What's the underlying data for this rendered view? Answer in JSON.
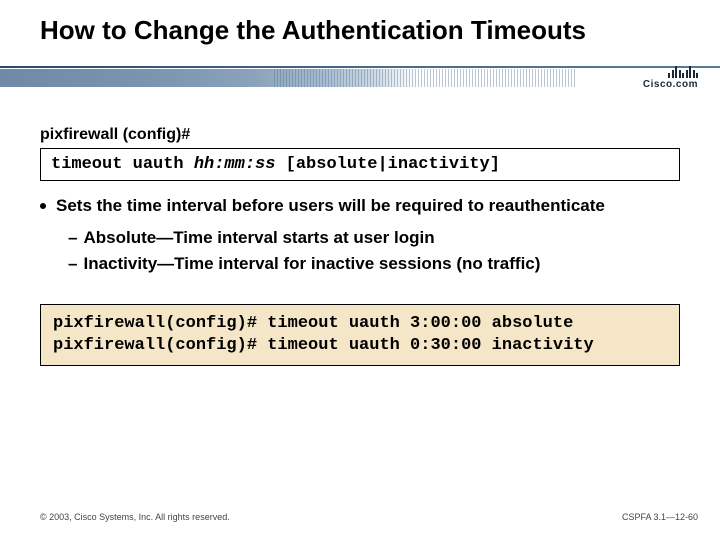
{
  "title": "How to Change the Authentication Timeouts",
  "logo": {
    "name": "Cisco.com"
  },
  "prompt_label": "pixfirewall (config)#",
  "syntax": {
    "cmd": "timeout uauth ",
    "args_italic": "hh:mm:ss",
    "tail": " [absolute|inactivity]"
  },
  "bullet": "Sets the time interval before users will be required to reauthenticate",
  "sub_items": [
    "Absolute—Time interval starts at user login",
    "Inactivity—Time interval for inactive sessions (no traffic)"
  ],
  "example_lines": [
    "pixfirewall(config)# timeout uauth 3:00:00 absolute",
    "pixfirewall(config)# timeout uauth 0:30:00 inactivity"
  ],
  "footer": {
    "copyright": "© 2003, Cisco Systems, Inc. All rights reserved.",
    "pageref": "CSPFA 3.1—12-60"
  }
}
